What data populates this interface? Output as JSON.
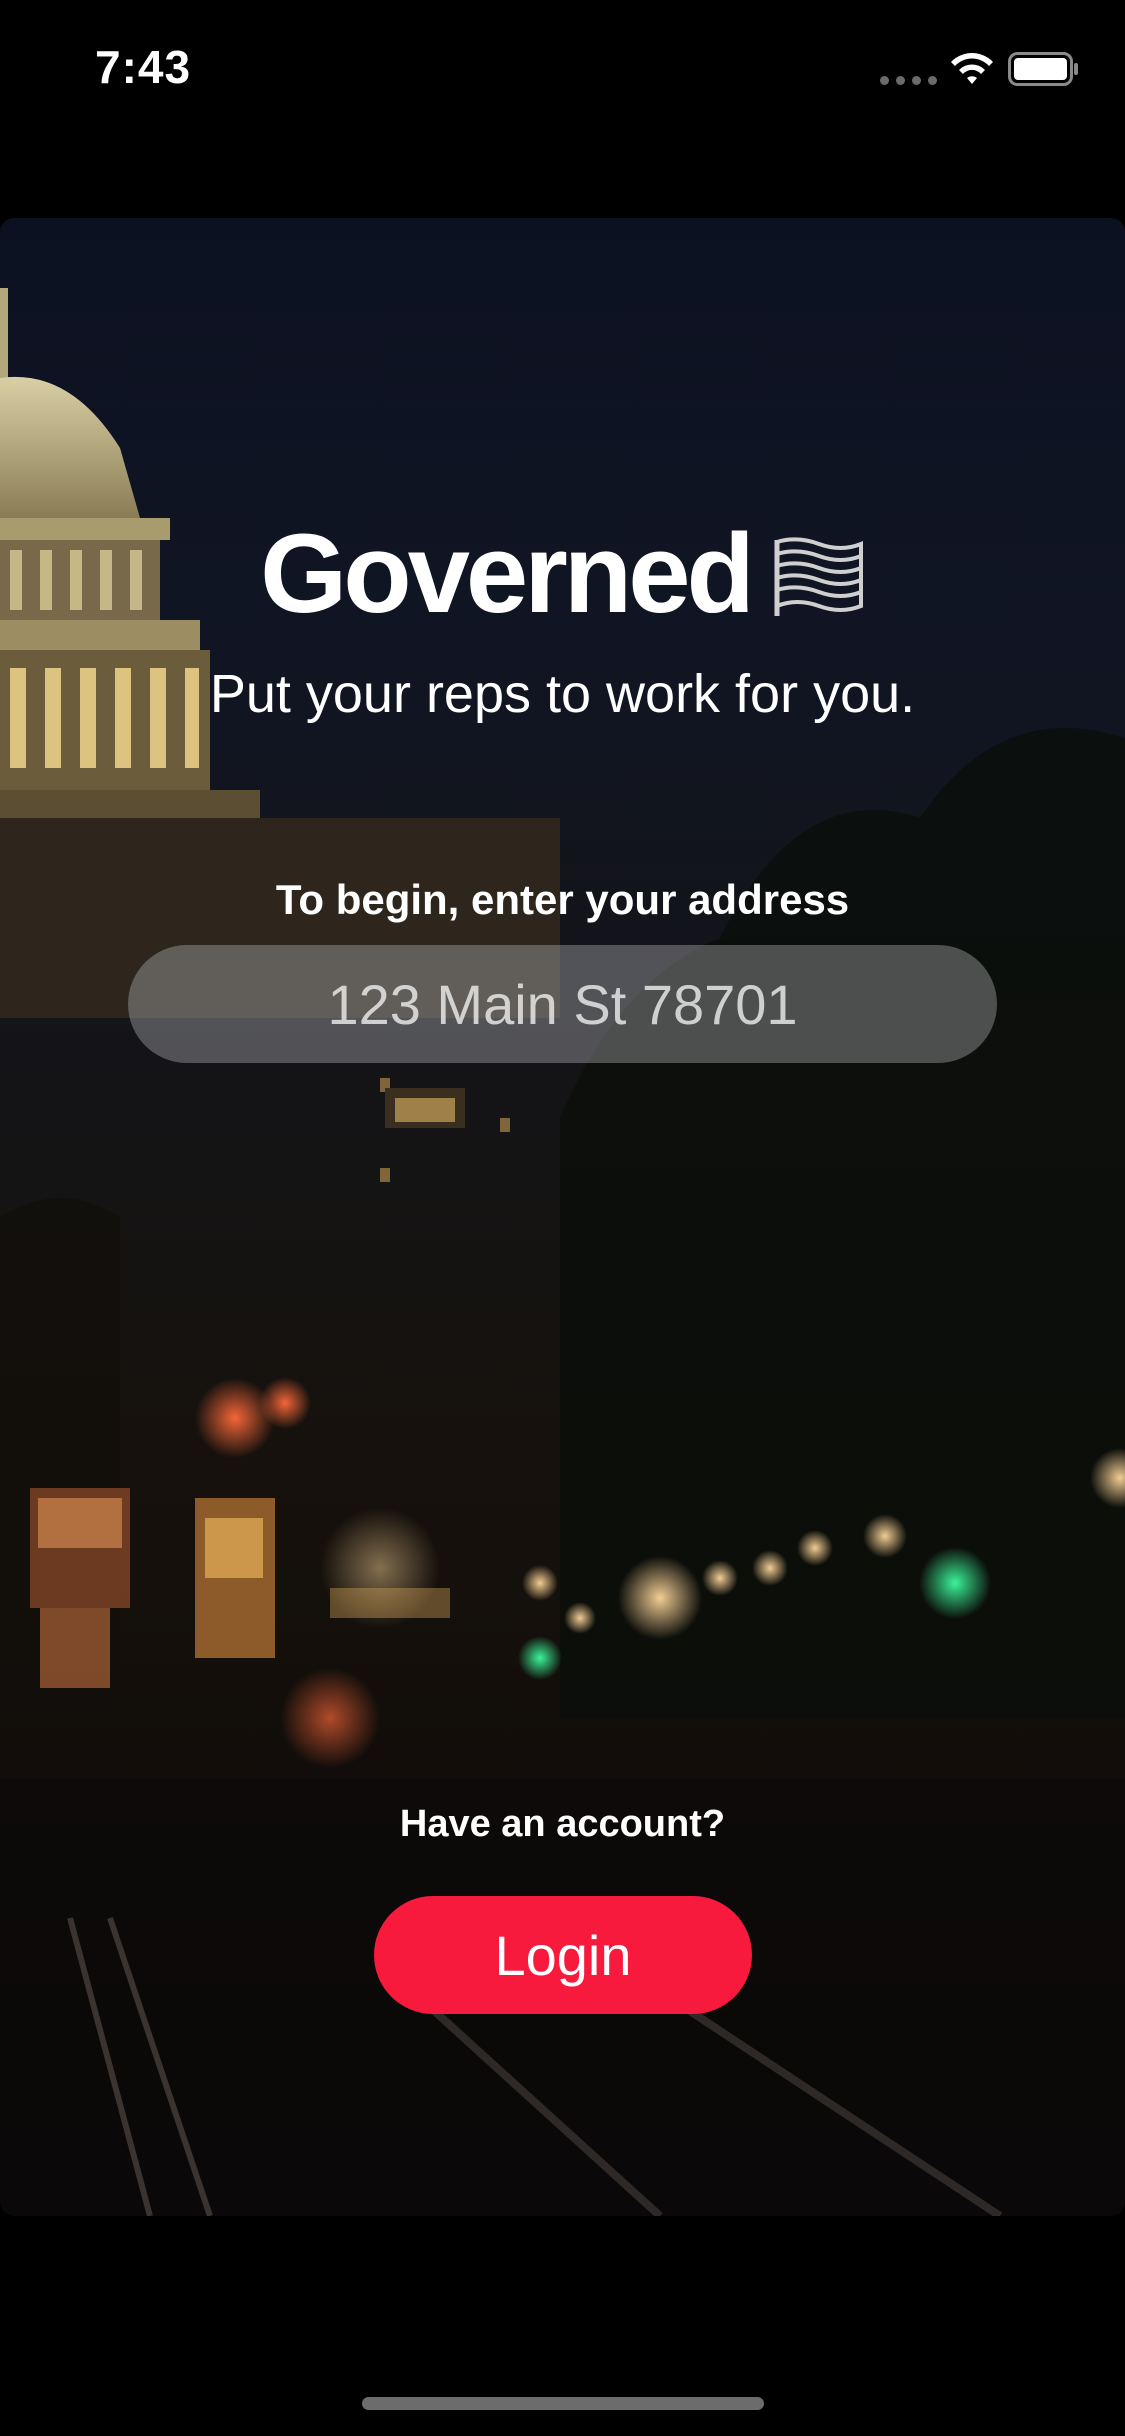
{
  "status_bar": {
    "time": "7:43"
  },
  "brand": {
    "name": "Governed",
    "logo_icon": "flag-icon"
  },
  "onboarding": {
    "tagline": "Put your reps to work for you.",
    "address_label": "To begin, enter your address",
    "address_placeholder": "123 Main St 78701"
  },
  "account": {
    "prompt": "Have an account?",
    "login_label": "Login"
  },
  "colors": {
    "accent": "#f71a3d",
    "background": "#000000"
  }
}
